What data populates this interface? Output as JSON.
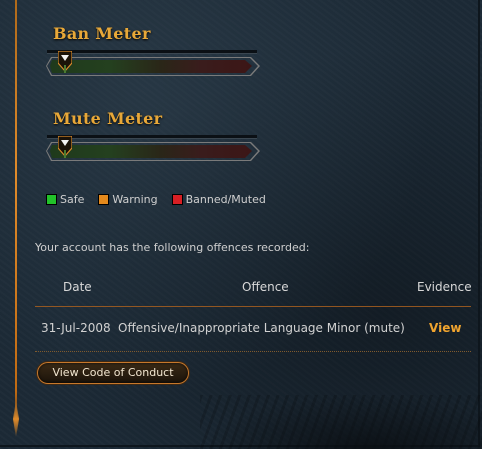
{
  "ban_meter": {
    "title": "Ban Meter",
    "level": 0.0
  },
  "mute_meter": {
    "title": "Mute Meter",
    "level": 0.0
  },
  "legend": [
    {
      "label": "Safe",
      "color": "#22c22a"
    },
    {
      "label": "Warning",
      "color": "#e58a1c"
    },
    {
      "label": "Banned/Muted",
      "color": "#d81f24"
    }
  ],
  "offences": {
    "intro": "Your account has the following offences recorded:",
    "headers": {
      "date": "Date",
      "offence": "Offence",
      "evidence": "Evidence"
    },
    "rows": [
      {
        "date": "31-Jul-2008",
        "offence": "Offensive/Inappropriate Language Minor (mute)",
        "evidence": "View"
      }
    ]
  },
  "buttons": {
    "code_of_conduct": "View Code of Conduct"
  },
  "colors": {
    "accent": "#e8a838",
    "link": "#f0a42f",
    "border_accent": "#a85f1e"
  }
}
